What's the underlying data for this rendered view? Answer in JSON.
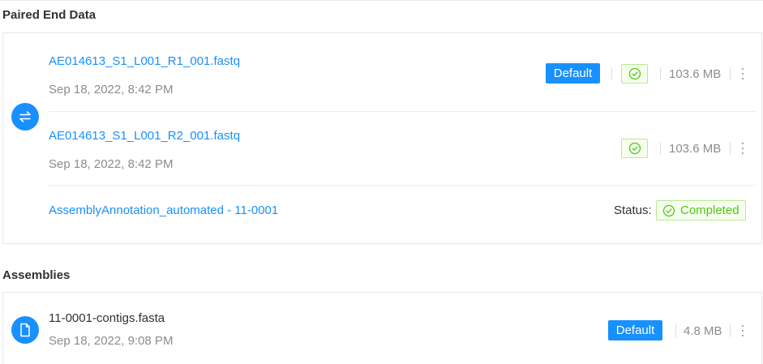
{
  "paired_end": {
    "section_title": "Paired End Data",
    "type_icon": "swap-arrows-icon",
    "files": [
      {
        "name": "AE014613_S1_L001_R1_001.fastq",
        "date": "Sep 18, 2022, 8:42 PM",
        "default_label": "Default",
        "status_icon": "check-circle-icon",
        "size": "103.6 MB"
      },
      {
        "name": "AE014613_S1_L001_R2_001.fastq",
        "date": "Sep 18, 2022, 8:42 PM",
        "status_icon": "check-circle-icon",
        "size": "103.6 MB"
      }
    ],
    "analysis": {
      "name": "AssemblyAnnotation_automated - 11-0001",
      "status_label": "Status:",
      "status_value": "Completed"
    }
  },
  "assemblies": {
    "section_title": "Assemblies",
    "type_icon": "file-icon",
    "files": [
      {
        "name": "11-0001-contigs.fasta",
        "date": "Sep 18, 2022, 9:08 PM",
        "default_label": "Default",
        "size": "4.8 MB"
      }
    ]
  },
  "colors": {
    "primary": "#1890ff",
    "success": "#52c41a",
    "success_bg": "#f6ffed",
    "success_border": "#b7eb8f",
    "muted_text": "#8c8c8c"
  }
}
